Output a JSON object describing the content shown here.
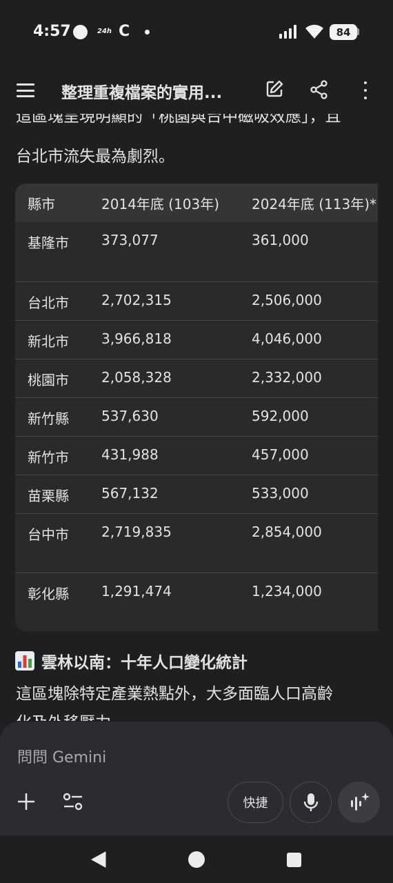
{
  "status_bar": {
    "time": "4:57",
    "indicator_24h": "24h",
    "app_letter": "C",
    "battery": "84"
  },
  "app_bar": {
    "title": "整理重複檔案的實用...",
    "menu_icon": "hamburger-menu-icon",
    "edit_icon": "edit-icon",
    "share_icon": "share-icon",
    "more_icon": "more-vert-icon"
  },
  "content": {
    "para_cut_line": "這區塊呈現明顯的「桃園與台中磁吸效應」，且",
    "para_line2": "台北市流失最為劇烈。",
    "table": {
      "headers": [
        "縣市",
        "2014年底 (103年)",
        "2024年底 (113年)*"
      ],
      "rows": [
        [
          "基隆市",
          "373,077",
          "361,000"
        ],
        [
          "台北市",
          "2,702,315",
          "2,506,000"
        ],
        [
          "新北市",
          "3,966,818",
          "4,046,000"
        ],
        [
          "桃園市",
          "2,058,328",
          "2,332,000"
        ],
        [
          "新竹縣",
          "537,630",
          "592,000"
        ],
        [
          "新竹市",
          "431,988",
          "457,000"
        ],
        [
          "苗栗縣",
          "567,132",
          "533,000"
        ],
        [
          "台中市",
          "2,719,835",
          "2,854,000"
        ],
        [
          "彰化縣",
          "1,291,474",
          "1,234,000"
        ]
      ]
    },
    "section_title": "雲林以南：十年人口變化統計",
    "section_line1": "這區塊除特定產業熱點外，大多面臨人口高齡",
    "section_line2": "化及外移壓力。"
  },
  "composer": {
    "placeholder": "問問 Gemini",
    "quick_label": "快捷"
  }
}
